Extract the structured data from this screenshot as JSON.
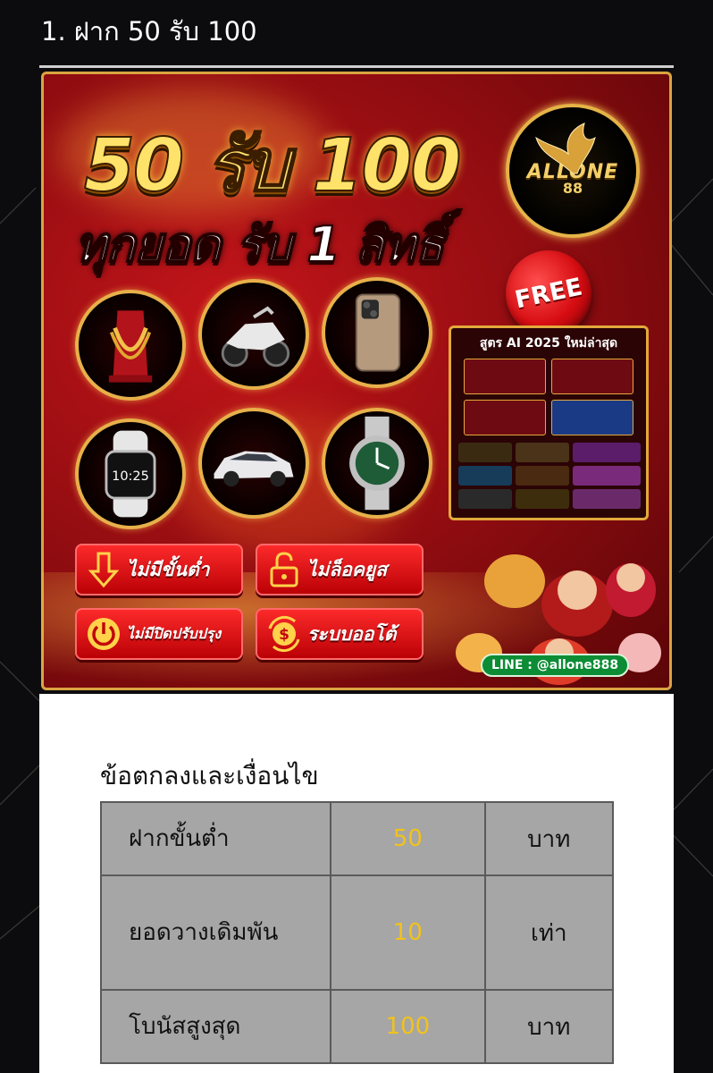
{
  "page": {
    "heading": "1. ฝาก 50 รับ 100"
  },
  "banner": {
    "headline_main": "50 รับ 100",
    "headline_sub": "ทุกยอด รับ 1 สิทธิ์",
    "logo_text": "ALLONE",
    "logo_number": "88",
    "free_badge": "FREE",
    "prizes": [
      "necklace-icon",
      "scooter-icon",
      "smartphone-icon",
      "smartwatch-icon",
      "car-icon",
      "wristwatch-icon"
    ],
    "smartwatch_time": "10:25",
    "promo_panel_title": "สูตร AI 2025 ใหม่ล่าสุด",
    "features": [
      {
        "icon": "arrow-down-icon",
        "label": "ไม่มีขั้นต่ำ"
      },
      {
        "icon": "unlock-icon",
        "label": "ไม่ล็อคยูส"
      },
      {
        "icon": "power-icon",
        "label": "ไม่มีปิดปรับปรุง"
      },
      {
        "icon": "dollar-refresh-icon",
        "label": "ระบบออโต้"
      }
    ],
    "line_contact": "LINE : @allone888",
    "colors": {
      "primary_red": "#c4151a",
      "gold": "#e5b347",
      "line_green": "#0b8c35"
    }
  },
  "terms": {
    "title": "ข้อตกลงและเงื่อนไข",
    "rows": [
      {
        "label": "ฝากขั้นต่ำ",
        "value": "50",
        "unit": "บาท"
      },
      {
        "label": "ยอดวางเดิมพัน",
        "value": "10",
        "unit": "เท่า"
      },
      {
        "label": "โบนัสสูงสุด",
        "value": "100",
        "unit": "บาท"
      }
    ],
    "colors": {
      "value_text": "#f2c21b",
      "table_bg": "#a6a6a6"
    }
  }
}
